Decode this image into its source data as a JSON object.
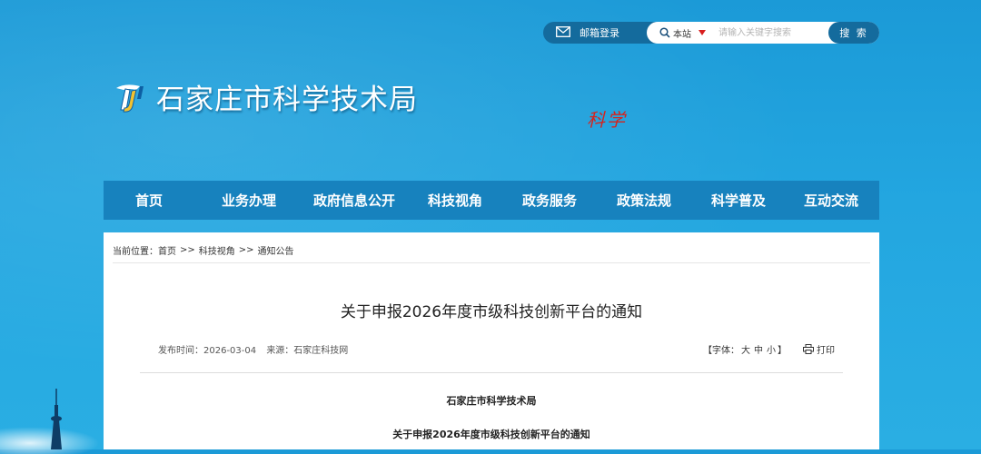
{
  "header": {
    "mailbox_label": "邮箱登录",
    "search_scope": "本站",
    "search_placeholder": "请输入关键字搜索",
    "search_button": "搜 索",
    "site_name": "石家庄市科学技术局",
    "logo_mark": "TJ",
    "science_mark": "科学"
  },
  "nav": {
    "items": [
      {
        "label": "首页"
      },
      {
        "label": "业务办理"
      },
      {
        "label": "政府信息公开"
      },
      {
        "label": "科技视角"
      },
      {
        "label": "政务服务"
      },
      {
        "label": "政策法规"
      },
      {
        "label": "科学普及"
      },
      {
        "label": "互动交流"
      }
    ]
  },
  "breadcrumb": {
    "prefix": "当前位置：",
    "items": [
      "首页",
      "科技视角",
      "通知公告"
    ],
    "separator": ">>"
  },
  "article": {
    "title": "关于申报2026年度市级科技创新平台的通知",
    "publish_label": "发布时间：2026-03-04",
    "source_label": "来源：石家庄科技网",
    "font_size_prefix": "【字体：",
    "font_sizes": [
      "大",
      "中",
      "小"
    ],
    "font_size_suffix": "】",
    "print_label": "打印",
    "body_org": "石家庄市科学技术局",
    "body_title": "关于申报2026年度市级科技创新平台的通知"
  },
  "colors": {
    "background": "#1b9ad7",
    "nav": "#1782be",
    "pill": "#146b9d",
    "accent_red": "#d6231c"
  }
}
